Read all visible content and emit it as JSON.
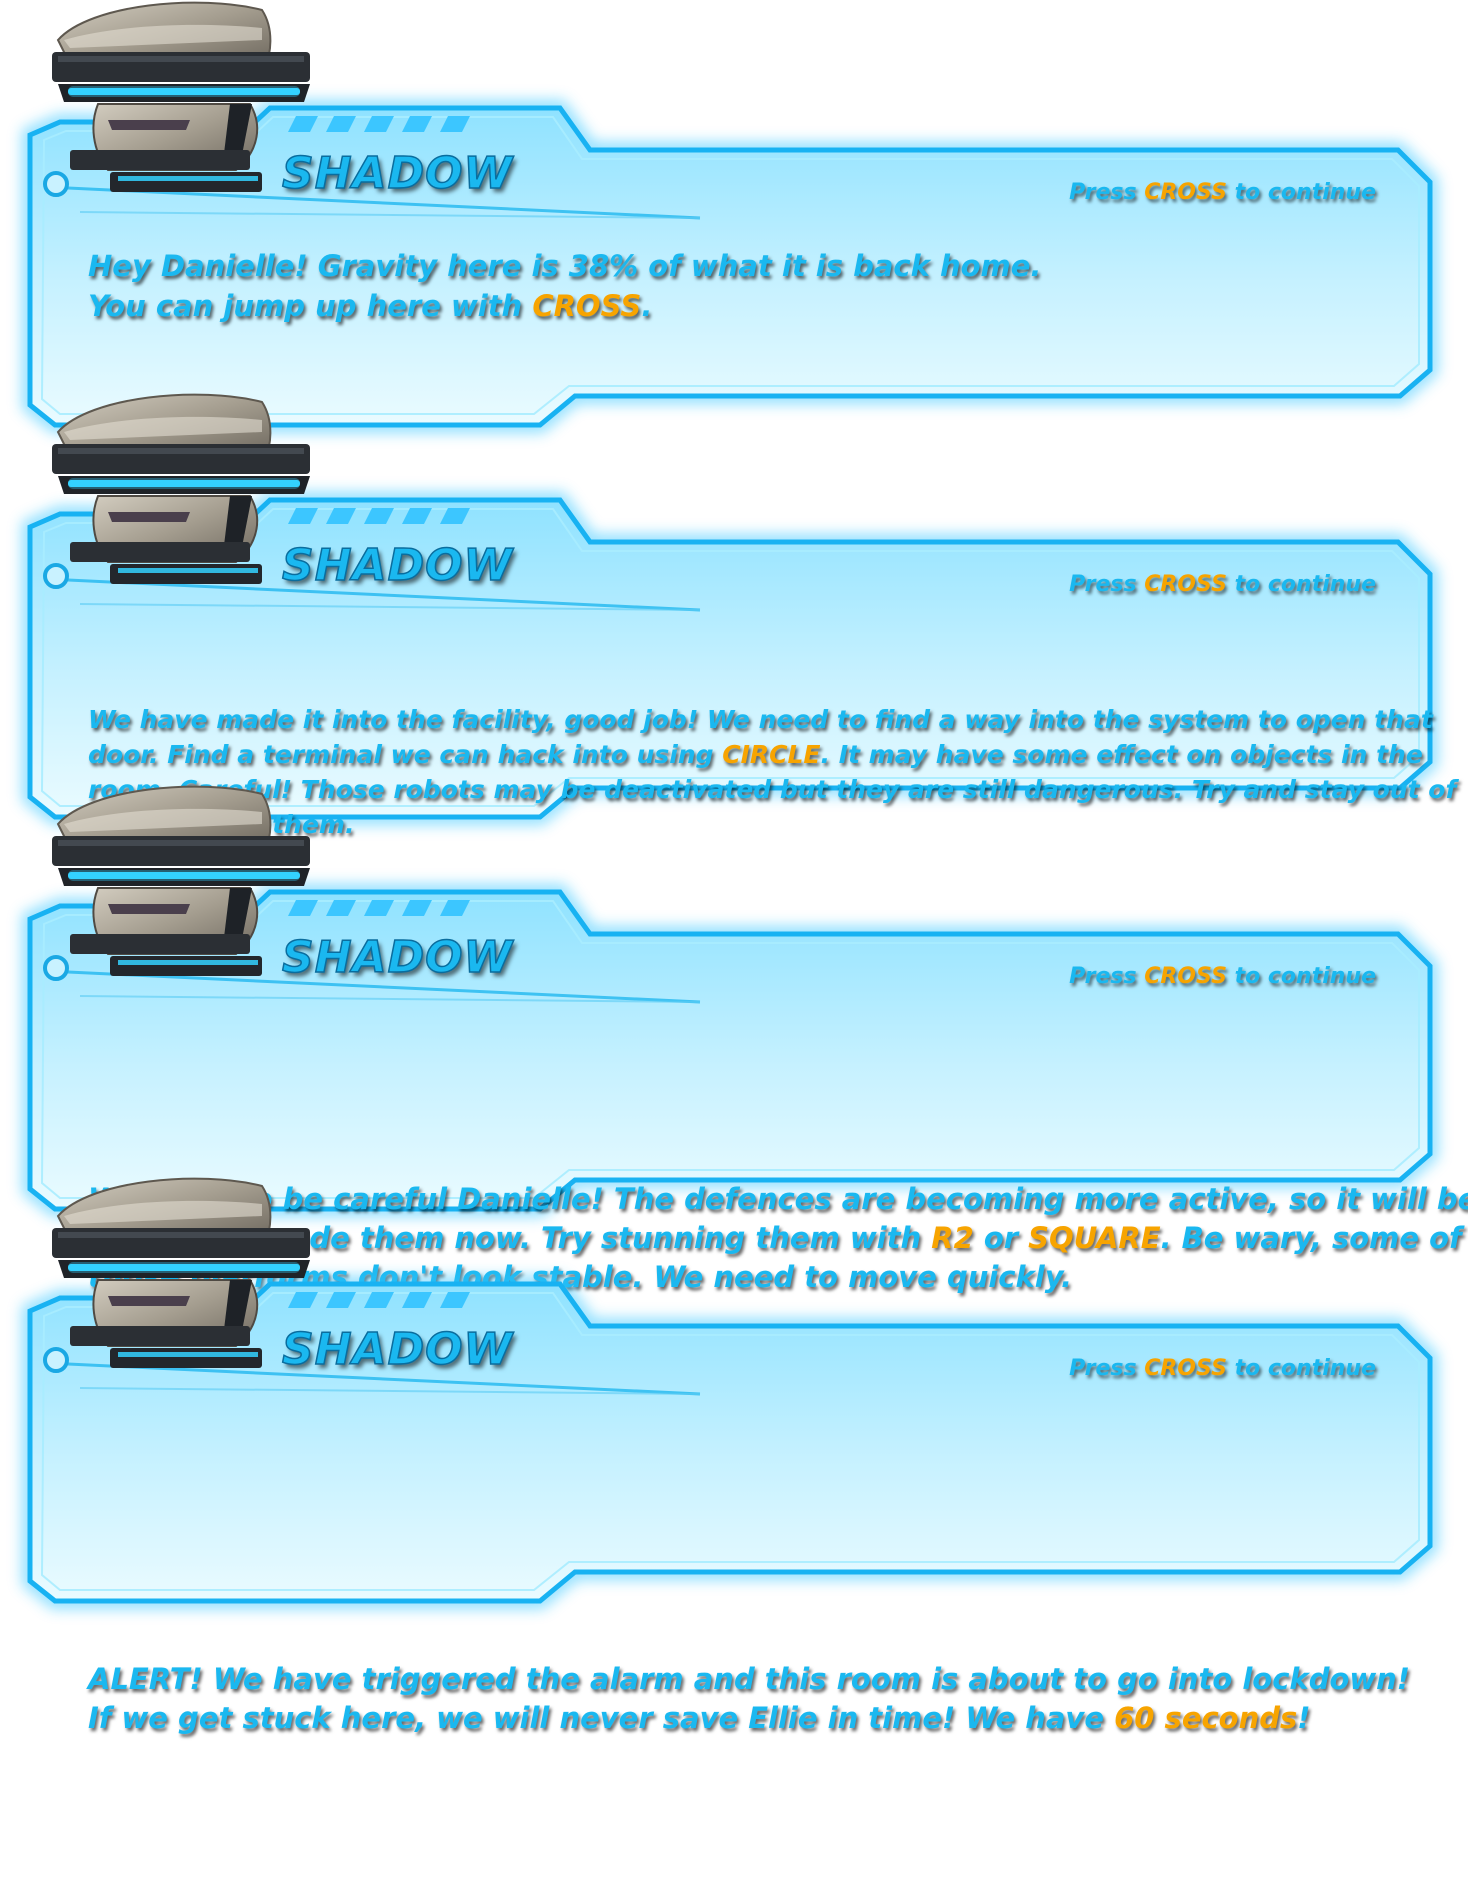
{
  "dialogs": [
    {
      "speaker": "SHADOW",
      "prompt": {
        "pre": "Press ",
        "key": "CROSS",
        "post": " to continue"
      },
      "lines": [
        [
          {
            "t": "Hey Danielle! Gravity here is 38% of what it is back home."
          }
        ],
        [
          {
            "t": "You can jump up here with "
          },
          {
            "t": "CROSS",
            "hl": true
          },
          {
            "t": "."
          }
        ]
      ]
    },
    {
      "speaker": "SHADOW",
      "prompt": {
        "pre": "Press ",
        "key": "CROSS",
        "post": " to continue"
      },
      "lines": [
        [
          {
            "t": "We have made it into the facility, good job! We need to find a way into the system to open that"
          }
        ],
        [
          {
            "t": "door. Find a terminal we can hack into using "
          },
          {
            "t": "CIRCLE",
            "hl": true
          },
          {
            "t": ". It may have some effect on objects in the"
          }
        ],
        [
          {
            "t": "room. Careful! Those robots may be deactivated but they are still dangerous. Try and stay out of"
          }
        ],
        [
          {
            "t": "contact with them."
          }
        ]
      ]
    },
    {
      "speaker": "SHADOW",
      "prompt": {
        "pre": "Press ",
        "key": "CROSS",
        "post": " to continue"
      },
      "lines": [
        [
          {
            "t": "We need to be careful Danielle! The defences are becoming more active, so it will be"
          }
        ],
        [
          {
            "t": "harder to evade them now. Try stunning them with "
          },
          {
            "t": "R2",
            "hl": true
          },
          {
            "t": " or "
          },
          {
            "t": "SQUARE",
            "hl": true
          },
          {
            "t": ". Be wary, some of"
          }
        ],
        [
          {
            "t": "those platforms don't look stable. We need to move quickly."
          }
        ]
      ]
    },
    {
      "speaker": "SHADOW",
      "prompt": {
        "pre": "Press ",
        "key": "CROSS",
        "post": " to continue"
      },
      "lines": [
        [
          {
            "t": "ALERT! We have triggered the alarm and this room is about to go into lockdown!"
          }
        ],
        [
          {
            "t": "If we get stuck here, we will never save Ellie in time! We have "
          },
          {
            "t": "60 seconds",
            "hl": true
          },
          {
            "t": "!"
          }
        ]
      ]
    }
  ],
  "colors": {
    "panel_fill": "#bdeeff",
    "panel_edge": "#19b6f5",
    "text": "#1ab8f0",
    "highlight": "#f7a400",
    "robot_shell": "#a9a294",
    "robot_dark": "#2a2e33",
    "robot_glow": "#34d2ff"
  },
  "icons": {
    "portrait": "robot-head-icon",
    "connector": "circuit-node-icon"
  }
}
